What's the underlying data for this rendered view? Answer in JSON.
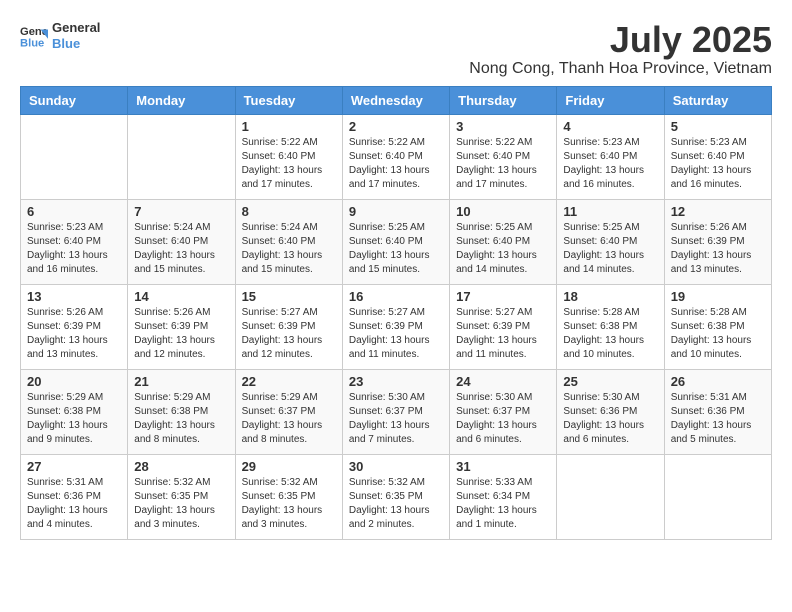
{
  "header": {
    "logo_general": "General",
    "logo_blue": "Blue",
    "title": "July 2025",
    "subtitle": "Nong Cong, Thanh Hoa Province, Vietnam"
  },
  "calendar": {
    "days_of_week": [
      "Sunday",
      "Monday",
      "Tuesday",
      "Wednesday",
      "Thursday",
      "Friday",
      "Saturday"
    ],
    "weeks": [
      [
        {
          "day": "",
          "info": ""
        },
        {
          "day": "",
          "info": ""
        },
        {
          "day": "1",
          "info": "Sunrise: 5:22 AM\nSunset: 6:40 PM\nDaylight: 13 hours and 17 minutes."
        },
        {
          "day": "2",
          "info": "Sunrise: 5:22 AM\nSunset: 6:40 PM\nDaylight: 13 hours and 17 minutes."
        },
        {
          "day": "3",
          "info": "Sunrise: 5:22 AM\nSunset: 6:40 PM\nDaylight: 13 hours and 17 minutes."
        },
        {
          "day": "4",
          "info": "Sunrise: 5:23 AM\nSunset: 6:40 PM\nDaylight: 13 hours and 16 minutes."
        },
        {
          "day": "5",
          "info": "Sunrise: 5:23 AM\nSunset: 6:40 PM\nDaylight: 13 hours and 16 minutes."
        }
      ],
      [
        {
          "day": "6",
          "info": "Sunrise: 5:23 AM\nSunset: 6:40 PM\nDaylight: 13 hours and 16 minutes."
        },
        {
          "day": "7",
          "info": "Sunrise: 5:24 AM\nSunset: 6:40 PM\nDaylight: 13 hours and 15 minutes."
        },
        {
          "day": "8",
          "info": "Sunrise: 5:24 AM\nSunset: 6:40 PM\nDaylight: 13 hours and 15 minutes."
        },
        {
          "day": "9",
          "info": "Sunrise: 5:25 AM\nSunset: 6:40 PM\nDaylight: 13 hours and 15 minutes."
        },
        {
          "day": "10",
          "info": "Sunrise: 5:25 AM\nSunset: 6:40 PM\nDaylight: 13 hours and 14 minutes."
        },
        {
          "day": "11",
          "info": "Sunrise: 5:25 AM\nSunset: 6:40 PM\nDaylight: 13 hours and 14 minutes."
        },
        {
          "day": "12",
          "info": "Sunrise: 5:26 AM\nSunset: 6:39 PM\nDaylight: 13 hours and 13 minutes."
        }
      ],
      [
        {
          "day": "13",
          "info": "Sunrise: 5:26 AM\nSunset: 6:39 PM\nDaylight: 13 hours and 13 minutes."
        },
        {
          "day": "14",
          "info": "Sunrise: 5:26 AM\nSunset: 6:39 PM\nDaylight: 13 hours and 12 minutes."
        },
        {
          "day": "15",
          "info": "Sunrise: 5:27 AM\nSunset: 6:39 PM\nDaylight: 13 hours and 12 minutes."
        },
        {
          "day": "16",
          "info": "Sunrise: 5:27 AM\nSunset: 6:39 PM\nDaylight: 13 hours and 11 minutes."
        },
        {
          "day": "17",
          "info": "Sunrise: 5:27 AM\nSunset: 6:39 PM\nDaylight: 13 hours and 11 minutes."
        },
        {
          "day": "18",
          "info": "Sunrise: 5:28 AM\nSunset: 6:38 PM\nDaylight: 13 hours and 10 minutes."
        },
        {
          "day": "19",
          "info": "Sunrise: 5:28 AM\nSunset: 6:38 PM\nDaylight: 13 hours and 10 minutes."
        }
      ],
      [
        {
          "day": "20",
          "info": "Sunrise: 5:29 AM\nSunset: 6:38 PM\nDaylight: 13 hours and 9 minutes."
        },
        {
          "day": "21",
          "info": "Sunrise: 5:29 AM\nSunset: 6:38 PM\nDaylight: 13 hours and 8 minutes."
        },
        {
          "day": "22",
          "info": "Sunrise: 5:29 AM\nSunset: 6:37 PM\nDaylight: 13 hours and 8 minutes."
        },
        {
          "day": "23",
          "info": "Sunrise: 5:30 AM\nSunset: 6:37 PM\nDaylight: 13 hours and 7 minutes."
        },
        {
          "day": "24",
          "info": "Sunrise: 5:30 AM\nSunset: 6:37 PM\nDaylight: 13 hours and 6 minutes."
        },
        {
          "day": "25",
          "info": "Sunrise: 5:30 AM\nSunset: 6:36 PM\nDaylight: 13 hours and 6 minutes."
        },
        {
          "day": "26",
          "info": "Sunrise: 5:31 AM\nSunset: 6:36 PM\nDaylight: 13 hours and 5 minutes."
        }
      ],
      [
        {
          "day": "27",
          "info": "Sunrise: 5:31 AM\nSunset: 6:36 PM\nDaylight: 13 hours and 4 minutes."
        },
        {
          "day": "28",
          "info": "Sunrise: 5:32 AM\nSunset: 6:35 PM\nDaylight: 13 hours and 3 minutes."
        },
        {
          "day": "29",
          "info": "Sunrise: 5:32 AM\nSunset: 6:35 PM\nDaylight: 13 hours and 3 minutes."
        },
        {
          "day": "30",
          "info": "Sunrise: 5:32 AM\nSunset: 6:35 PM\nDaylight: 13 hours and 2 minutes."
        },
        {
          "day": "31",
          "info": "Sunrise: 5:33 AM\nSunset: 6:34 PM\nDaylight: 13 hours and 1 minute."
        },
        {
          "day": "",
          "info": ""
        },
        {
          "day": "",
          "info": ""
        }
      ]
    ]
  }
}
